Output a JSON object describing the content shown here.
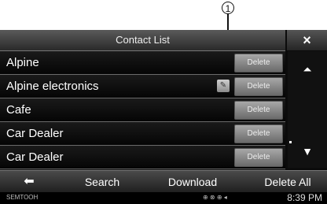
{
  "callout": {
    "number": "1"
  },
  "header": {
    "title": "Contact List",
    "close_label": "×"
  },
  "contacts": [
    {
      "name": "Alpine",
      "delete_label": "Delete",
      "has_edit": false
    },
    {
      "name": "Alpine electronics",
      "delete_label": "Delete",
      "has_edit": true
    },
    {
      "name": "Cafe",
      "delete_label": "Delete",
      "has_edit": false
    },
    {
      "name": "Car Dealer",
      "delete_label": "Delete",
      "has_edit": false
    },
    {
      "name": "Car Dealer",
      "delete_label": "Delete",
      "has_edit": false
    }
  ],
  "scroll": {
    "top_icon": "⏶",
    "down_icon": "▼"
  },
  "bottom": {
    "back_icon": "⬅",
    "search_label": "Search",
    "download_label": "Download",
    "delete_all_label": "Delete All"
  },
  "status": {
    "left": "SEMTOOH",
    "icons": "⊕ ⊗ ⊕ ◂",
    "time": "8:39 PM"
  }
}
